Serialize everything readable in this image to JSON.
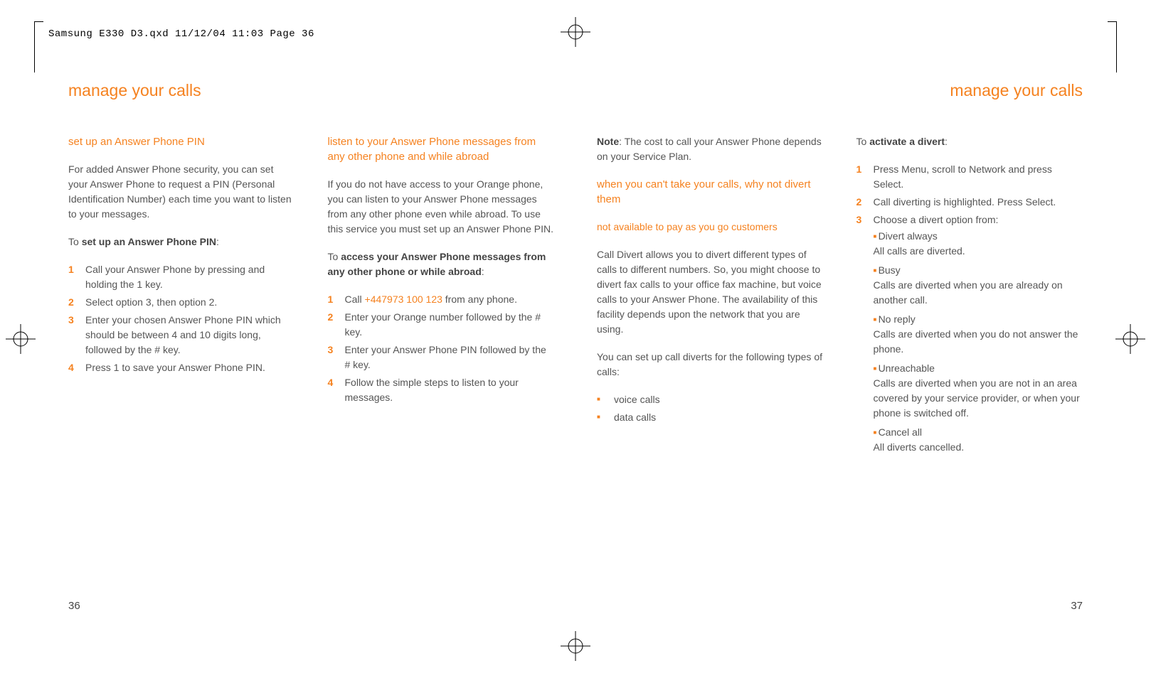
{
  "slug": "Samsung E330 D3.qxd  11/12/04  11:03  Page 36",
  "left": {
    "heading": "manage your calls",
    "pageNum": "36",
    "col1": {
      "h": "set up an Answer Phone PIN",
      "p1": "For added Answer Phone security, you can set your Answer Phone to request a PIN (Personal Identification Number) each time you want to listen to your messages.",
      "lead_pre": "To ",
      "lead_bold": "set up an Answer Phone PIN",
      "lead_post": ":",
      "steps": [
        "Call your Answer Phone by pressing and holding the 1 key.",
        "Select option 3, then option 2.",
        "Enter your chosen Answer Phone PIN which should be between 4 and 10 digits long, followed by the # key.",
        "Press 1 to save your Answer Phone PIN."
      ]
    },
    "col2": {
      "h": "listen to your Answer Phone messages from any other phone and while abroad",
      "p1": "If you do not have access to your Orange phone, you can listen to your Answer Phone messages from any other phone even while abroad. To use this service you must set up an Answer Phone PIN.",
      "lead_pre": "To ",
      "lead_bold": "access your Answer Phone messages from any other phone or while abroad",
      "lead_post": ":",
      "phone": "+447973 100 123",
      "step1_pre": "Call ",
      "step1_post": " from any phone.",
      "steps_rest": [
        "Enter your Orange number followed by the # key.",
        "Enter your Answer Phone PIN followed by the # key.",
        "Follow the simple steps to listen to your messages."
      ]
    }
  },
  "right": {
    "heading": "manage your calls",
    "pageNum": "37",
    "col1": {
      "note_bold": "Note",
      "note_rest": ": The cost to call your Answer Phone depends on your Service Plan.",
      "h": "when you can't take your calls, why not divert them",
      "avail": "not available to pay as you go customers",
      "p1": "Call Divert allows you to divert different types of calls to different numbers. So, you might choose to divert fax calls to your office fax machine, but voice calls to your Answer Phone. The availability of this facility depends upon the network that you are using.",
      "p2": "You can set up call diverts for the following types of calls:",
      "bul": [
        "voice calls",
        "data calls"
      ]
    },
    "col2": {
      "lead_pre": "To ",
      "lead_bold": "activate a divert",
      "lead_post": ":",
      "steps": [
        "Press Menu, scroll to Network and press Select.",
        "Call diverting is highlighted. Press Select.",
        "Choose a divert option from:"
      ],
      "opts": [
        {
          "t": "Divert always",
          "d": "All calls are diverted."
        },
        {
          "t": "Busy",
          "d": "Calls are diverted when you are already on another call."
        },
        {
          "t": "No reply",
          "d": "Calls are diverted when you do not answer the phone."
        },
        {
          "t": "Unreachable",
          "d": "Calls are diverted when you are not in an area covered by your service provider, or when your phone is switched off."
        },
        {
          "t": "Cancel all",
          "d": "All diverts cancelled."
        }
      ]
    }
  }
}
